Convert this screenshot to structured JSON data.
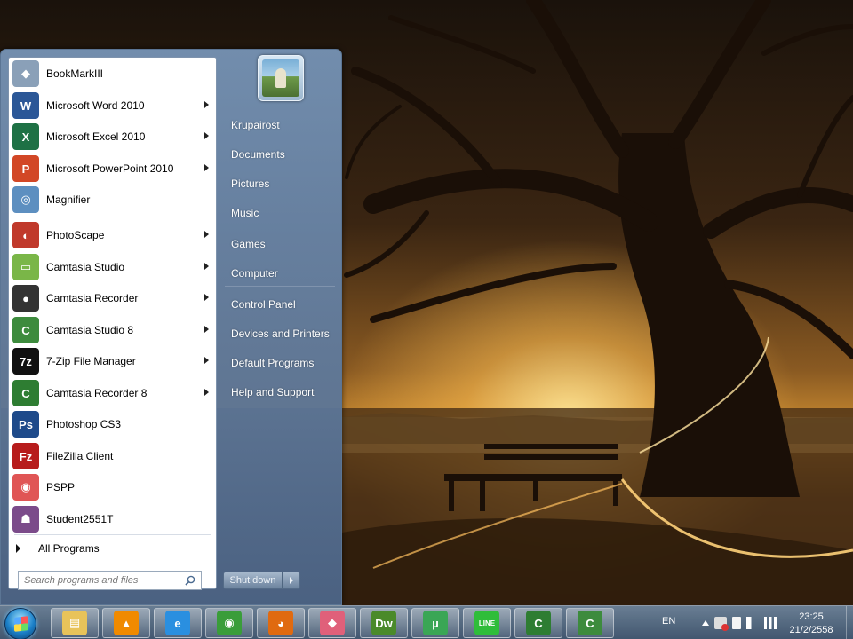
{
  "start_menu": {
    "programs": [
      {
        "label": "BookMarkIII",
        "icon": "bookmark-icon",
        "arrow": false,
        "color": "#8aa0b8",
        "glyph": "◆"
      },
      {
        "label": "Microsoft Word 2010",
        "icon": "word-icon",
        "arrow": true,
        "color": "#2b5797",
        "glyph": "W"
      },
      {
        "label": "Microsoft Excel 2010",
        "icon": "excel-icon",
        "arrow": true,
        "color": "#1e7145",
        "glyph": "X"
      },
      {
        "label": "Microsoft PowerPoint 2010",
        "icon": "powerpoint-icon",
        "arrow": true,
        "color": "#d24726",
        "glyph": "P"
      },
      {
        "label": "Magnifier",
        "icon": "magnifier-icon",
        "arrow": false,
        "color": "#5d8fc0",
        "glyph": "◎"
      },
      {
        "label": "PhotoScape",
        "icon": "photoscape-icon",
        "arrow": true,
        "color": "#c0392b",
        "glyph": "◐"
      },
      {
        "label": "Camtasia Studio",
        "icon": "camtasia-studio-icon",
        "arrow": true,
        "color": "#7ab648",
        "glyph": "▭"
      },
      {
        "label": "Camtasia Recorder",
        "icon": "camtasia-recorder-icon",
        "arrow": true,
        "color": "#333333",
        "glyph": "●"
      },
      {
        "label": "Camtasia Studio 8",
        "icon": "camtasia-studio-8-icon",
        "arrow": true,
        "color": "#3d8b3d",
        "glyph": "C"
      },
      {
        "label": "7-Zip File Manager",
        "icon": "7zip-icon",
        "arrow": true,
        "color": "#111111",
        "glyph": "7z"
      },
      {
        "label": "Camtasia Recorder 8",
        "icon": "camtasia-recorder-8-icon",
        "arrow": true,
        "color": "#2e7d32",
        "glyph": "C"
      },
      {
        "label": "Photoshop CS3",
        "icon": "photoshop-icon",
        "arrow": false,
        "color": "#1e4a8a",
        "glyph": "Ps"
      },
      {
        "label": "FileZilla Client",
        "icon": "filezilla-icon",
        "arrow": false,
        "color": "#b71c1c",
        "glyph": "Fz"
      },
      {
        "label": "PSPP",
        "icon": "pspp-icon",
        "arrow": false,
        "color": "#e05555",
        "glyph": "◉"
      },
      {
        "label": "Student2551T",
        "icon": "student-icon",
        "arrow": false,
        "color": "#7b4b8a",
        "glyph": "☗"
      }
    ],
    "all_programs": "All Programs",
    "search_placeholder": "Search programs and files",
    "right_items": [
      "Krupairost",
      "Documents",
      "Pictures",
      "Music",
      "Games",
      "Computer",
      "Control Panel",
      "Devices and Printers",
      "Default Programs",
      "Help and Support"
    ],
    "shutdown_label": "Shut down"
  },
  "taskbar": {
    "apps": [
      {
        "name": "explorer",
        "icon": "folder-icon",
        "color": "#e8c35a",
        "glyph": "▤"
      },
      {
        "name": "vlc",
        "icon": "vlc-icon",
        "color": "#f08a00",
        "glyph": "▲"
      },
      {
        "name": "internet-explorer",
        "icon": "ie-icon",
        "color": "#2a8fe0",
        "glyph": "e"
      },
      {
        "name": "chrome",
        "icon": "chrome-icon",
        "color": "#3a9d3a",
        "glyph": "◉"
      },
      {
        "name": "firefox",
        "icon": "firefox-icon",
        "color": "#e06a10",
        "glyph": "◕"
      },
      {
        "name": "eraser",
        "icon": "eraser-icon",
        "color": "#e0607a",
        "glyph": "◆"
      },
      {
        "name": "dreamweaver",
        "icon": "dreamweaver-icon",
        "color": "#4a8a2a",
        "glyph": "Dw"
      },
      {
        "name": "utorrent",
        "icon": "utorrent-icon",
        "color": "#3aa655",
        "glyph": "µ"
      },
      {
        "name": "line",
        "icon": "line-icon",
        "color": "#2fbd3a",
        "glyph": "LINE"
      },
      {
        "name": "camtasia-recorder",
        "icon": "camtasia-recorder-taskbar-icon",
        "color": "#2e7d32",
        "glyph": "C"
      },
      {
        "name": "camtasia-studio",
        "icon": "camtasia-studio-taskbar-icon",
        "color": "#3d8b3d",
        "glyph": "C"
      }
    ],
    "language": "EN",
    "time": "23:25",
    "date": "21/2/2558"
  }
}
